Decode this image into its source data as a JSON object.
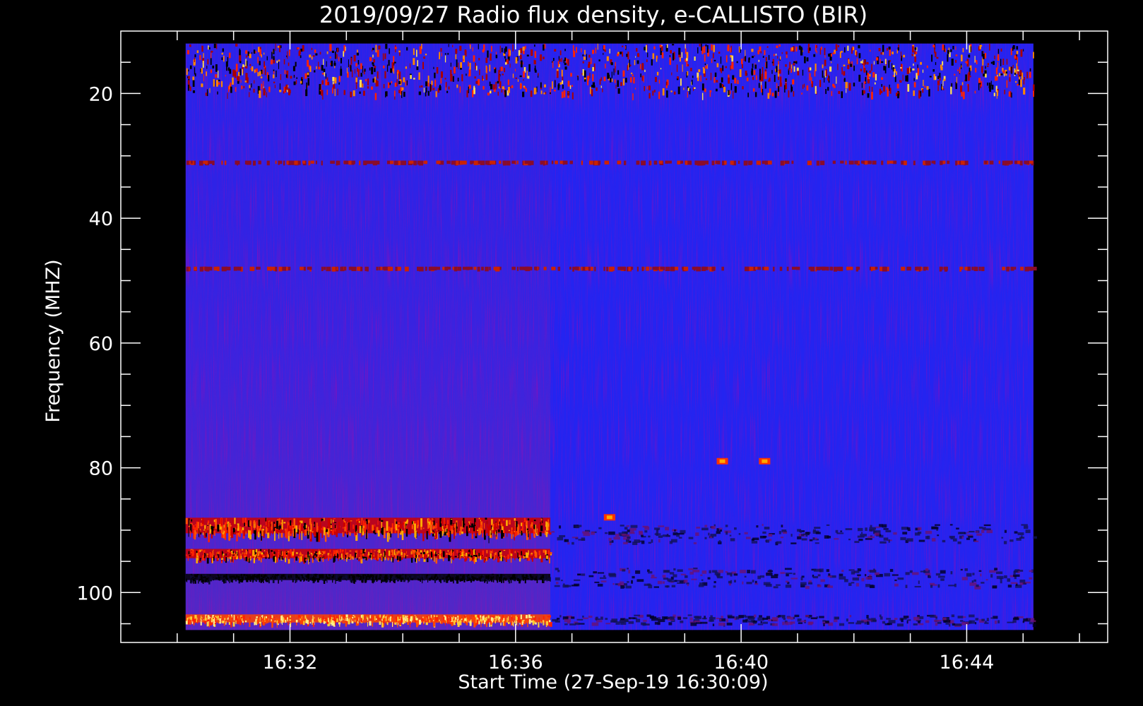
{
  "chart_data": {
    "type": "heatmap",
    "title": "2019/09/27  Radio flux density, e-CALLISTO (BIR)",
    "xlabel": "Start Time (27-Sep-19 16:30:09)",
    "ylabel": "Frequency (MHZ)",
    "x_ticks": [
      "16:32",
      "16:36",
      "16:40",
      "16:44"
    ],
    "y_ticks": [
      "20",
      "40",
      "60",
      "80",
      "100"
    ],
    "x_range": [
      "16:29:00",
      "16:46:30"
    ],
    "x_data_range": [
      "16:30:09",
      "16:45:11"
    ],
    "y_range": [
      10,
      108
    ],
    "y_data_range": [
      12,
      106
    ],
    "y_axis_inverted": true,
    "colormap": [
      "#000000",
      "#2222ff",
      "#aa0000",
      "#ff3300",
      "#ffcc00",
      "#ffffcc"
    ],
    "background_color": "#2424f0",
    "features": [
      {
        "kind": "band",
        "freq_range": [
          12,
          20
        ],
        "time_range": [
          "16:30:09",
          "16:45:11"
        ],
        "intensity": "high, sporadic bursts"
      },
      {
        "kind": "line",
        "freq": 31,
        "time_range": [
          "16:30:09",
          "16:45:11"
        ],
        "intensity": "medium, intermittent"
      },
      {
        "kind": "line",
        "freq": 48,
        "time_range": [
          "16:30:09",
          "16:45:11"
        ],
        "intensity": "medium, intermittent"
      },
      {
        "kind": "band",
        "freq_range": [
          88,
          90.5
        ],
        "time_range": [
          "16:30:09",
          "16:36:37"
        ],
        "intensity": "high"
      },
      {
        "kind": "band",
        "freq_range": [
          93,
          94.5
        ],
        "time_range": [
          "16:30:09",
          "16:36:37"
        ],
        "intensity": "high"
      },
      {
        "kind": "band",
        "freq_range": [
          97,
          98
        ],
        "time_range": [
          "16:30:09",
          "16:36:37"
        ],
        "intensity": "low (dark)"
      },
      {
        "kind": "band",
        "freq_range": [
          103.5,
          104.8
        ],
        "time_range": [
          "16:30:09",
          "16:36:37"
        ],
        "intensity": "very high"
      },
      {
        "kind": "spot",
        "freq": 79,
        "time": "16:39:40",
        "intensity": "high"
      },
      {
        "kind": "spot",
        "freq": 79,
        "time": "16:40:25",
        "intensity": "high"
      },
      {
        "kind": "spot",
        "freq": 88,
        "time": "16:37:40",
        "intensity": "high"
      }
    ]
  }
}
